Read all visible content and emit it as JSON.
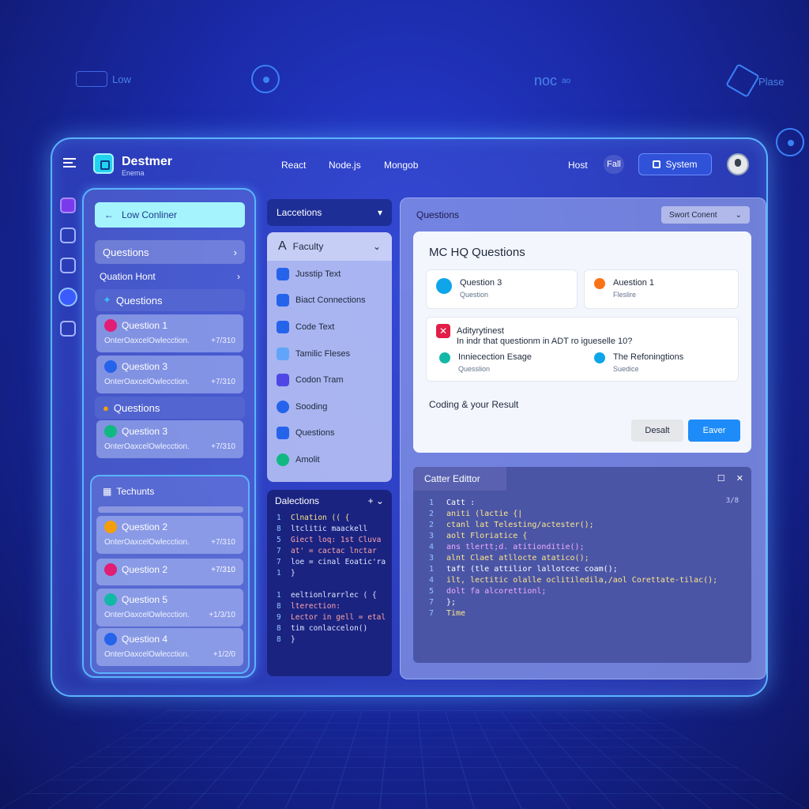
{
  "background": {
    "deco_left": "Low",
    "deco_center": "noc",
    "deco_center_sub": "ao",
    "deco_right": "Plase"
  },
  "header": {
    "brand": "Destmer",
    "brand_sub": "Enema",
    "nav": [
      "React",
      "Node.js",
      "Mongob"
    ],
    "host": "Host",
    "fail": "Fall",
    "system": "System"
  },
  "sidebar": {
    "low_button": "Low Conliner",
    "questions_head": "Questions",
    "question_host": "Quation Hont",
    "group1_label": "Questions",
    "group1_items": [
      {
        "title": "Question 1",
        "sub": "OnterOaxcelOwlecction.",
        "meta": "+7/310",
        "color": "#e11d74"
      },
      {
        "title": "Question 3",
        "sub": "OnterOaxcelOwlecction.",
        "meta": "+7/310",
        "color": "#2563eb"
      }
    ],
    "group2_label": "Questions",
    "group2_items": [
      {
        "title": "Question 3",
        "sub": "OnterOaxcelOwlecction.",
        "meta": "+7/310",
        "color": "#10b981"
      }
    ],
    "techunts_label": "Techunts",
    "techunts_items": [
      {
        "title": "Question 2",
        "sub": "OnterOaxcelOwlecction.",
        "meta": "+7/310",
        "color": "#f59e0b"
      },
      {
        "title": "Question 2",
        "sub": "",
        "meta": "+7/310",
        "color": "#e11d74"
      },
      {
        "title": "Question 5",
        "sub": "OnterOaxcelOwlecction.",
        "meta": "+1/3/10",
        "color": "#14b8a6"
      },
      {
        "title": "Question 4",
        "sub": "OnterOaxcelOwlecction.",
        "meta": "+1/2/0",
        "color": "#2563eb"
      }
    ]
  },
  "middle": {
    "lacections_label": "Laccetions",
    "faculty_label": "Faculty",
    "items": [
      "Jusstip Text",
      "Biact Connections",
      "Code Text",
      "Tamilic Fleses",
      "Codon Tram",
      "Sooding",
      "Questions",
      "Amolit"
    ],
    "dalections_label": "Dalections",
    "code_lines": [
      {
        "n": "1",
        "t": "Clnation (( {"
      },
      {
        "n": "8",
        "t": "  ltclitic maackell"
      },
      {
        "n": "5",
        "t": "    Giect loq: 1st Cluva"
      },
      {
        "n": "7",
        "t": "    at' = cactac lnctar"
      },
      {
        "n": "7",
        "t": "    loe = cinal Eoatic'ra"
      },
      {
        "n": "1",
        "t": "}"
      },
      {
        "n": "",
        "t": ""
      },
      {
        "n": "1",
        "t": "eeltionlrarrlec ( {"
      },
      {
        "n": "8",
        "t": "  lterection:"
      },
      {
        "n": "9",
        "t": "    Lector in gell = etal"
      },
      {
        "n": "8",
        "t": "    tim conlaccelon()"
      },
      {
        "n": "8",
        "t": "}"
      }
    ]
  },
  "main": {
    "questions_label": "Questions",
    "sort_label": "Swort Conent",
    "card_title": "MC HQ Questions",
    "options": [
      {
        "l1": "Question 3",
        "l2": "Question",
        "color": "#0ea5e9"
      },
      {
        "l1": "Auestion 1",
        "l2": "Fleslire",
        "color": "#f97316"
      }
    ],
    "big_title": "Adityrytinest",
    "big_question": "In indr that questionm in ADT ro igueselle 10?",
    "sub_options": [
      {
        "l1": "Inniecection Esage",
        "l2": "Quesslion",
        "color": "#14b8a6"
      },
      {
        "l1": "The Refoningtions",
        "l2": "Suedice",
        "color": "#0ea5e9"
      }
    ],
    "result_label": "Coding & your Result",
    "desalt_label": "Desalt",
    "eaver_label": "Eaver",
    "editor_title": "Catter Edittor",
    "editor_meta": "3/8",
    "editor_lines": [
      {
        "n": "1",
        "t": "Catt :"
      },
      {
        "n": "2",
        "t": "aniti (lactie {|"
      },
      {
        "n": "2",
        "t": "ctanl lat Telesting/actester();"
      },
      {
        "n": "3",
        "t": "aolt Floriatice  {"
      },
      {
        "n": "4",
        "t": "ans  tlertt;d. atitionditie();"
      },
      {
        "n": "3",
        "t": "  alnt Claet atllocte  atatico();"
      },
      {
        "n": "1",
        "t": "  taft (tle attilior lallotcec coam();"
      },
      {
        "n": "4",
        "t": "    ilt, lectitic olalle oclitiledila,/aol Corettate-tilac();"
      },
      {
        "n": "5",
        "t": "    dolt fa alcorettionl;"
      },
      {
        "n": "7",
        "t": "};"
      },
      {
        "n": "7",
        "t": "Time"
      }
    ]
  }
}
